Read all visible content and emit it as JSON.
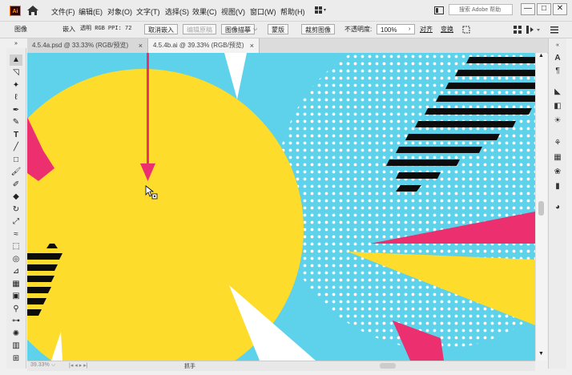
{
  "app": {
    "logo_text": "Ai"
  },
  "menu": [
    "文件(F)",
    "编辑(E)",
    "对象(O)",
    "文字(T)",
    "选择(S)",
    "效果(C)",
    "视图(V)",
    "窗口(W)",
    "帮助(H)"
  ],
  "search": {
    "placeholder": "搜索 Adobe 帮助"
  },
  "window_controls": {
    "minimize": "—",
    "maximize": "□",
    "close": "✕"
  },
  "control_bar": {
    "object_type": "图像",
    "embed": "嵌入",
    "info": "透明  RGB  PPI: 72",
    "unembed": "取消嵌入",
    "edit_original": "编辑原稿",
    "image_trace": "图像描摹",
    "mask": "蒙版",
    "crop_image": "裁剪图像",
    "opacity_label": "不透明度:",
    "opacity_value": "100%",
    "align": "对齐",
    "transform": "变换"
  },
  "tabs": [
    {
      "label": "4.5.4a.psd @ 33.33% (RGB/预览)",
      "close": "×",
      "active": false
    },
    {
      "label": "4.5.4b.ai @ 39.33% (RGB/预览)",
      "close": "×",
      "active": true
    }
  ],
  "status": {
    "zoom": "39.33%",
    "tool": "抓手"
  },
  "colors": {
    "cyan": "#5dd2ea",
    "yellow": "#fddc2b",
    "pink": "#ec2f6f",
    "black": "#0c0c0c",
    "white": "#ffffff"
  },
  "icons": {
    "tools": [
      "selection-tool-icon",
      "direct-selection-tool-icon",
      "magic-wand-tool-icon",
      "lasso-tool-icon",
      "pen-tool-icon",
      "curvature-tool-icon",
      "type-tool-icon",
      "line-tool-icon",
      "rectangle-tool-icon",
      "paintbrush-tool-icon",
      "shaper-tool-icon",
      "eraser-tool-icon",
      "rotate-tool-icon",
      "scale-tool-icon",
      "warp-tool-icon",
      "free-transform-tool-icon",
      "shape-builder-tool-icon",
      "perspective-grid-tool-icon",
      "mesh-tool-icon",
      "gradient-tool-icon",
      "eyedropper-tool-icon",
      "blend-tool-icon",
      "symbol-sprayer-tool-icon",
      "column-graph-tool-icon",
      "artboard-tool-icon"
    ]
  }
}
